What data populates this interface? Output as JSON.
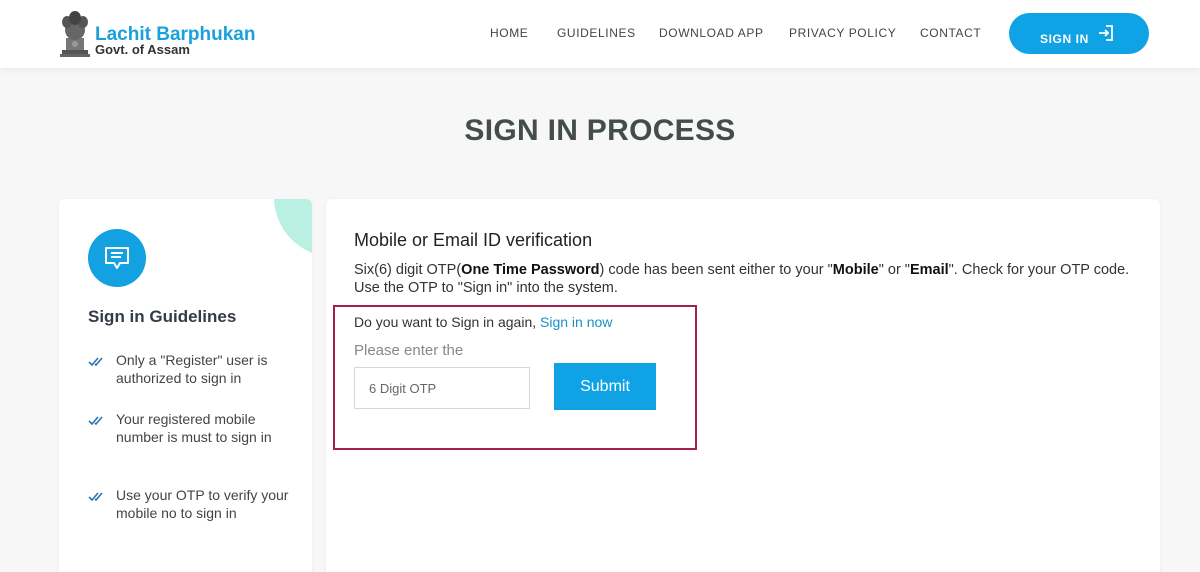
{
  "header": {
    "logo_title": "Lachit Barphukan",
    "logo_subtitle": "Govt. of Assam",
    "nav": [
      "HOME",
      "GUIDELINES",
      "DOWNLOAD APP",
      "PRIVACY POLICY",
      "CONTACT"
    ],
    "signin_label": "SIGN IN"
  },
  "page_title": "SIGN IN PROCESS",
  "guidelines": {
    "title": "Sign in Guidelines",
    "items": [
      "Only a \"Register\" user is authorized to sign in",
      "Your registered mobile number is must to sign in",
      "Use your OTP to verify your mobile no to sign in"
    ]
  },
  "verification": {
    "title": "Mobile or Email ID verification",
    "desc_prefix": "Six(6) digit OTP(",
    "desc_bold_1": "One Time Password",
    "desc_mid_1": ") code has been sent either to your \"",
    "desc_bold_2": "Mobile",
    "desc_mid_2": "\" or \"",
    "desc_bold_3": "Email",
    "desc_suffix": "\". Check for your OTP code. Use the OTP to \"Sign in\" into the system.",
    "again_text": "Do you want to Sign in again, ",
    "again_link": "Sign in now",
    "enter_label": "Please enter the",
    "otp_placeholder": "6 Digit OTP",
    "submit_label": "Submit"
  },
  "colors": {
    "accent": "#0fa3e6",
    "highlight_border": "#a3224b",
    "deco_mint": "#b9f0e2"
  },
  "icons": {
    "emblem": "national-emblem-icon",
    "signin": "sign-in-arrow-icon",
    "guide": "chat-bubble-icon",
    "bullet": "double-check-icon"
  }
}
